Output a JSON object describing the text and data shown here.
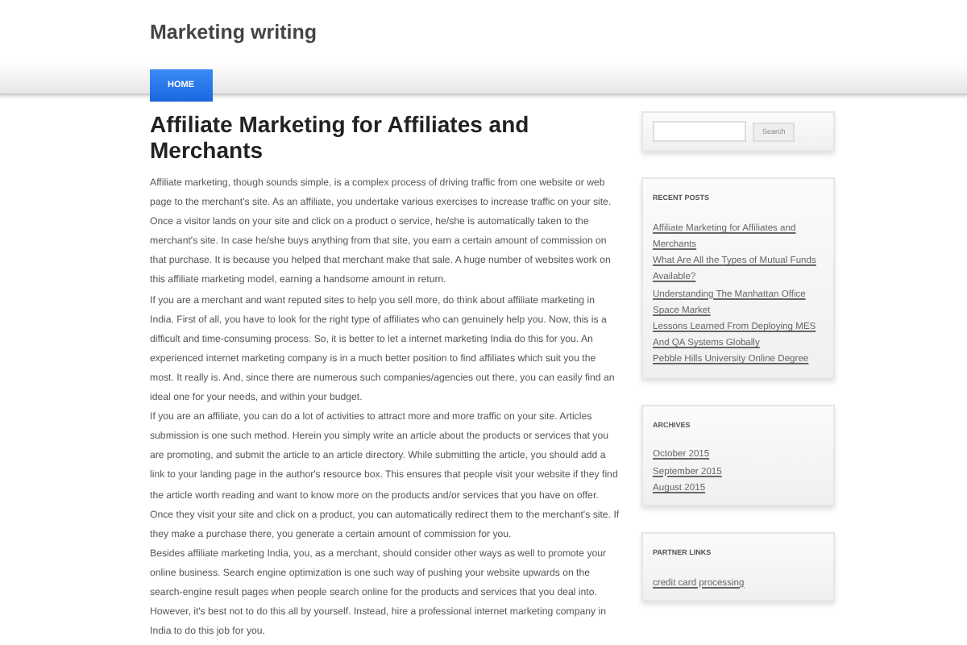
{
  "site_title": "Marketing writing",
  "nav": [
    {
      "label": "HOME",
      "selected": true
    }
  ],
  "article": {
    "title": "Affiliate Marketing for Affiliates and Merchants",
    "paragraphs": [
      "Affiliate marketing, though sounds simple, is a complex process of driving traffic from one website or web page to the merchant's site. As an affiliate, you undertake various exercises to increase traffic on your site. Once a visitor lands on your site and click on a product o service, he/she is automatically taken to the merchant's site. In case he/she buys anything from that site, you earn a certain amount of commission on that purchase. It is because you helped that merchant make that sale. A huge number of websites work on this affiliate marketing model, earning a handsome amount in return.",
      "If you are a merchant and want reputed sites to help you sell more, do think about affiliate marketing in India. First of all, you have to look for the right type of affiliates who can genuinely help you. Now, this is a difficult and time-consuming process. So, it is better to let a internet marketing India do this for you. An experienced internet marketing company is in a much better position to find affiliates which suit you the most. It really is. And, since there are numerous such companies/agencies out there, you can easily find an ideal one for your needs, and within your budget.",
      "If you are an affiliate, you can do a lot of activities to attract more and more traffic on your site. Articles submission is one such method. Herein you simply write an article about the products or services that you are promoting, and submit the article to an article directory. While submitting the article, you should add a link to your landing page in the author's resource box. This ensures that people visit your website if they find the article worth reading and want to know more on the products and/or services that you have on offer. Once they visit your site and click on a product, you can automatically redirect them to the merchant's site. If they make a purchase there, you generate a certain amount of commission for you.",
      "Besides affiliate marketing India, you, as a merchant, should consider other ways as well to promote your online business. Search engine optimization is one such way of pushing your website upwards on the search-engine result pages when people search online for the products and services that you deal into. However, it's best not to do this all by yourself. Instead, hire a professional internet marketing company in India to do this job for you."
    ]
  },
  "search": {
    "button": "Search"
  },
  "widgets": [
    {
      "title": "RECENT POSTS",
      "links": [
        "Affiliate Marketing for Affiliates and Merchants",
        "What Are All the Types of Mutual Funds Available?",
        "Understanding The Manhattan Office Space Market",
        "Lessons Learned From Deploying MES And QA Systems Globally",
        "Pebble Hills University Online Degree"
      ]
    },
    {
      "title": "ARCHIVES",
      "links": [
        "October 2015",
        "September 2015",
        "August 2015"
      ]
    },
    {
      "title": "PARTNER LINKS",
      "links": [
        "credit card processing"
      ]
    }
  ]
}
